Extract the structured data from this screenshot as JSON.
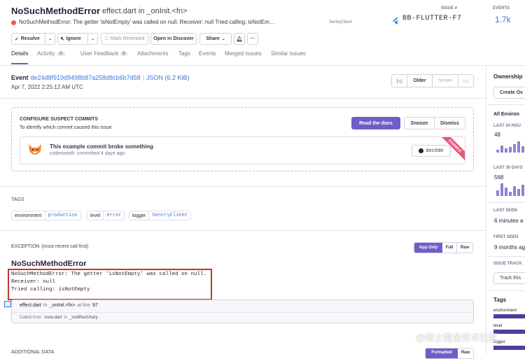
{
  "issue": {
    "type": "NoSuchMethodError",
    "culprit": "effect.dart in _onInit.<fn>",
    "message": "NoSuchMethodError: The getter 'isNotEmpty' was called on null. Receiver: null Tried calling: isNotEm…",
    "logger": "SentryClient"
  },
  "stats": {
    "issue_label": "ISSUE #",
    "issue_id": "BB-FLUTTER-F7",
    "events_label": "EVENTS",
    "events_value": "1.7k"
  },
  "actions": {
    "resolve": "Resolve",
    "ignore": "Ignore",
    "mark_reviewed": "Mark Reviewed",
    "open_in_discover": "Open in Discover",
    "share": "Share",
    "more": "···"
  },
  "tabs": [
    {
      "label": "Details",
      "active": true
    },
    {
      "label": "Activity",
      "count": "0"
    },
    {
      "label": "User Feedback",
      "count": "0"
    },
    {
      "label": "Attachments"
    },
    {
      "label": "Tags"
    },
    {
      "label": "Events"
    },
    {
      "label": "Merged Issues"
    },
    {
      "label": "Similar Issues"
    }
  ],
  "event": {
    "label": "Event",
    "id": "de24d8f919d9498b87a258d8cb6b7d58",
    "json": "JSON (6.2 KiB)",
    "date": "Apr 7, 2022 2:25:12 AM UTC",
    "older": "Older",
    "newer": "Newer"
  },
  "suspect": {
    "title": "CONFIGURE SUSPECT COMMITS",
    "subtitle": "To identify which commit caused this issue",
    "read_docs": "Read the docs",
    "snooze": "Snooze",
    "dismiss": "Dismiss",
    "commit_title": "This example commit broke something",
    "commit_author": "codesworth",
    "commit_when": "committed 4 days ago",
    "commit_hash": "dec0de",
    "ribbon": "EXAMPLE"
  },
  "tags_section": {
    "title": "TAGS",
    "items": [
      {
        "key": "environment",
        "value": "production"
      },
      {
        "key": "level",
        "value": "error"
      },
      {
        "key": "logger",
        "value": "SentryClient"
      }
    ]
  },
  "exception": {
    "title": "EXCEPTION",
    "subtitle": "(most recent call first)",
    "app_only": "App Only",
    "full": "Full",
    "raw": "Raw",
    "type": "NoSuchMethodError",
    "lines": [
      "NoSuchMethodError: The getter 'isNotEmpty' was called on null.",
      "Receiver: null",
      "Tried calling: isNotEmpty"
    ],
    "frame_file": "effect.dart",
    "frame_in": "in",
    "frame_func": "_onInit.<fn>",
    "frame_at": "at line",
    "frame_line": "97",
    "called_from_label": "Called from:",
    "called_from_file": "zone.dart",
    "called_from_func": "_rootRunUnary"
  },
  "additional": {
    "title": "ADDITIONAL DATA",
    "formatted": "Formatted",
    "raw": "Raw"
  },
  "sidebar": {
    "ownership": "Ownership",
    "create": "Create Ov",
    "all_env": "All Environ",
    "last24_label": "LAST 24 HOU",
    "last24_value": "48",
    "last30_label": "LAST 30 DAYS",
    "last30_value": "568",
    "last_seen_label": "LAST SEEN",
    "last_seen_value": "6 minutes a",
    "first_seen_label": "FIRST SEEN",
    "first_seen_value": "9 months ag",
    "tracking_label": "ISSUE TRACK",
    "tracking_value": "Track this",
    "tags_label": "Tags",
    "tag_environment": "environment",
    "tag_level": "level",
    "tag_logger": "logger"
  },
  "watermark": "@稀土掘金技术社区",
  "colors": {
    "accent": "#6c5fc7",
    "link": "#3d74db",
    "error_dot": "#f55459",
    "highlight_box": "#c0392b"
  }
}
